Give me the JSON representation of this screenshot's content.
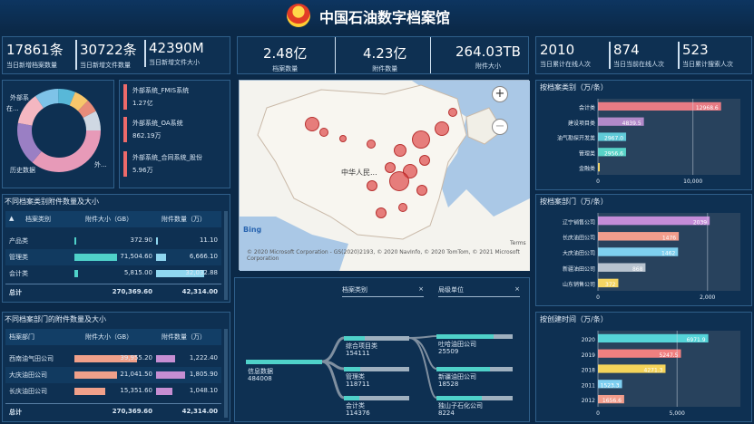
{
  "header": {
    "title": "中国石油数字档案馆"
  },
  "kpis_left": [
    {
      "value": "17861条",
      "label": "当日新增档案数量"
    },
    {
      "value": "30722条",
      "label": "当日新增文件数量"
    },
    {
      "value": "42390M",
      "label": "当日新增文件大小"
    }
  ],
  "kpis_mid": [
    {
      "value": "2.48亿",
      "label": "档案数量"
    },
    {
      "value": "4.23亿",
      "label": "附件数量"
    },
    {
      "value": "264.03TB",
      "label": "附件大小"
    }
  ],
  "kpis_right": [
    {
      "value": "2010",
      "label": "当日累计在线人次"
    },
    {
      "value": "874",
      "label": "当日当前在线人次"
    },
    {
      "value": "523",
      "label": "当日累计搜索人次"
    }
  ],
  "donut": {
    "labels": [
      "外部系",
      "在...",
      "历史数据",
      "外..."
    ],
    "colors": [
      "#e79ab8",
      "#9a7fc4",
      "#7ec3e8",
      "#f4b7c1",
      "#8bd6e6",
      "#58b8d8",
      "#f7c66b",
      "#e88c7a",
      "#cfd8e3"
    ]
  },
  "systems": [
    {
      "name": "外部系统_FMIS系统",
      "value": "1.27亿"
    },
    {
      "name": "外部系统_OA系统",
      "value": "862.19万"
    },
    {
      "name": "外部系统_合同系统_股份",
      "value": "5.96万"
    }
  ],
  "table1": {
    "title": "不同档案类别附件数量及大小",
    "headers": [
      "档案类别",
      "附件大小（GB）",
      "附件数量（万）"
    ],
    "rows": [
      {
        "name": "产品类",
        "size": "372.90",
        "count": "11.10",
        "sizeFrac": 0.01,
        "countFrac": 0.01
      },
      {
        "name": "管理类",
        "size": "71,504.60",
        "count": "6,666.10",
        "sizeFrac": 0.55,
        "countFrac": 0.16
      },
      {
        "name": "会计类",
        "size": "5,815.00",
        "count": "32,032.88",
        "sizeFrac": 0.05,
        "countFrac": 0.76
      }
    ],
    "total": {
      "name": "总计",
      "size": "270,369.60",
      "count": "42,314.00"
    }
  },
  "table2": {
    "title": "不同档案部门的附件数量及大小",
    "headers": [
      "档案部门",
      "附件大小（GB）",
      "附件数量（万）"
    ],
    "rows": [
      {
        "name": "西南油气田公司",
        "size": "39,955.20",
        "count": "1,222.40",
        "sizeFrac": 0.8,
        "countFrac": 0.3
      },
      {
        "name": "大庆油田公司",
        "size": "21,041.50",
        "count": "1,805.90",
        "sizeFrac": 0.55,
        "countFrac": 0.45
      },
      {
        "name": "长庆油田公司",
        "size": "15,351.60",
        "count": "1,048.10",
        "sizeFrac": 0.4,
        "countFrac": 0.26
      }
    ],
    "total": {
      "name": "总计",
      "size": "270,369.60",
      "count": "42,314.00"
    }
  },
  "map": {
    "label": "中华人民...",
    "bing": "Bing",
    "copyright": "© 2020 Microsoft Corporation - GS(2020)2193, © 2020 NavInfo, © 2020 TomTom, © 2021 Microsoft Corporation",
    "terms": "Terms",
    "zoom_in": "+",
    "zoom_out": "−"
  },
  "tree": {
    "col1": "档案类别",
    "col2": "局级单位",
    "close": "×",
    "root": {
      "name": "信息数据",
      "value": "484008"
    },
    "mid": [
      {
        "name": "综合项目类",
        "value": "154111"
      },
      {
        "name": "管理类",
        "value": "118711"
      },
      {
        "name": "会计类",
        "value": "114376"
      }
    ],
    "right": [
      {
        "name": "吐哈油田公司",
        "value": "25509"
      },
      {
        "name": "新疆油田公司",
        "value": "18528"
      },
      {
        "name": "独山子石化公司",
        "value": "8224"
      }
    ]
  },
  "chart_data": [
    {
      "type": "bar",
      "title": "按档案类别（万/条）",
      "categories": [
        "会计类",
        "建设项目类",
        "油气勘探开发类",
        "管理类",
        "金融类"
      ],
      "values": [
        12968.6,
        4839.5,
        2967.0,
        2956.6,
        150
      ],
      "data_labels": [
        "12968.6",
        "4839.5",
        "2967.0",
        "2956.6",
        ""
      ],
      "colors": [
        "#e87b84",
        "#b289c9",
        "#60cad8",
        "#58d3c7",
        "#f4d45a"
      ],
      "xlim": [
        0,
        15000
      ],
      "ticks": [
        "0",
        "10,000"
      ]
    },
    {
      "type": "bar",
      "title": "按档案部门（万/条）",
      "categories": [
        "辽宁销售公司",
        "长庆油田公司",
        "大庆油田公司",
        "新疆油田公司",
        "山东销售公司"
      ],
      "values": [
        2039,
        1476,
        1462,
        868,
        372
      ],
      "data_labels": [
        "2039",
        "1476",
        "1462",
        "868",
        "372"
      ],
      "colors": [
        "#c58cd8",
        "#f29d8c",
        "#7ed0ef",
        "#b8c3cf",
        "#f5d563"
      ],
      "xlim": [
        0,
        2600
      ],
      "ticks": [
        "0",
        "2,000"
      ]
    },
    {
      "type": "bar",
      "title": "按创建时间（万/条）",
      "categories": [
        "2020",
        "2019",
        "2018",
        "2011",
        "2012"
      ],
      "values": [
        6971.9,
        5247.5,
        4271.3,
        1523.3,
        1656.6
      ],
      "data_labels": [
        "6971.9",
        "5247.5",
        "4271.3",
        "1523.3",
        "1656.6"
      ],
      "colors": [
        "#55d4d8",
        "#f08080",
        "#f4d45a",
        "#7ecff1",
        "#f29d8c"
      ],
      "xlim": [
        0,
        9000
      ],
      "ticks": [
        "0",
        "5,000"
      ]
    }
  ]
}
